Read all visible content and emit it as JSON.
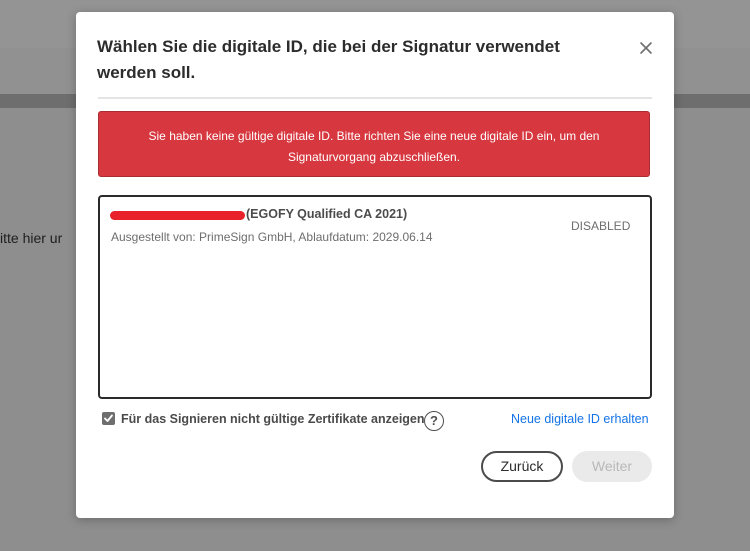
{
  "background": {
    "partial_text": "itte hier ur"
  },
  "dialog": {
    "title": "Wählen Sie die digitale ID, die bei der Signatur verwendet werden soll.",
    "close_icon": "close-icon",
    "error_message": "Sie haben keine gültige digitale ID. Bitte richten Sie eine neue digitale ID ein, um den Signaturvorgang abzuschließen.",
    "ids": [
      {
        "name": "(EGOFY Qualified CA 2021)",
        "issuer": "Ausgestellt von: PrimeSign GmbH, Ablaufdatum: 2029.06.14",
        "status": "DISABLED",
        "redacted": true
      }
    ],
    "show_invalid_checkbox": {
      "label": "Für das Signieren nicht gültige Zertifikate anzeigen",
      "checked": true
    },
    "help_icon": "?",
    "new_id_link": "Neue digitale ID erhalten",
    "buttons": {
      "back": "Zurück",
      "next": "Weiter"
    }
  },
  "colors": {
    "error_banner": "#d7373f",
    "link": "#1473e6",
    "redaction": "#e8212a"
  }
}
